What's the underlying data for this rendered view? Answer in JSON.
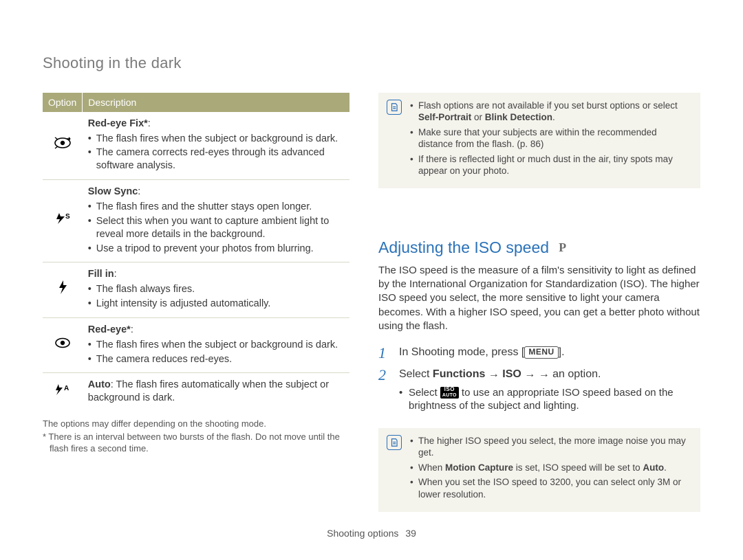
{
  "header": {
    "title": "Shooting in the dark"
  },
  "table": {
    "head": {
      "option": "Option",
      "description": "Description"
    },
    "rows": [
      {
        "icon": "redeye-fix-icon",
        "name": "Red-eye Fix*",
        "bullets": [
          "The flash fires when the subject or background is dark.",
          "The camera corrects red-eyes through its advanced software analysis."
        ]
      },
      {
        "icon": "slow-sync-icon",
        "name": "Slow Sync",
        "bullets": [
          "The flash fires and the shutter stays open longer.",
          "Select this when you want to capture ambient light to reveal more details in the background.",
          "Use a tripod to prevent your photos from blurring."
        ]
      },
      {
        "icon": "fill-in-icon",
        "name": "Fill in",
        "bullets": [
          "The flash always fires.",
          "Light intensity is adjusted automatically."
        ]
      },
      {
        "icon": "redeye-icon",
        "name": "Red-eye*",
        "bullets": [
          "The flash fires when the subject or background is dark.",
          "The camera reduces red-eyes."
        ]
      },
      {
        "icon": "auto-flash-icon",
        "auto_label": "Auto",
        "auto_text": ": The flash fires automatically when the subject or background is dark."
      }
    ]
  },
  "footnotes": {
    "a": "The options may differ depending on the shooting mode.",
    "b": "* There is an interval between two bursts of the flash. Do not move until the flash fires a second time."
  },
  "notes_top": {
    "b1_a": "Flash options are not available if you set burst options or select ",
    "b1_b": "Self-Portrait",
    "b1_c": " or ",
    "b1_d": "Blink Detection",
    "b1_e": ".",
    "b2": "Make sure that your subjects are within the recommended distance from the flash. (p. 86)",
    "b3": "If there is reflected light or much dust in the air, tiny spots may appear on your photo."
  },
  "section": {
    "title": "Adjusting the ISO speed",
    "mode": "P",
    "body": "The ISO speed is the measure of a film's sensitivity to light as defined by the International Organization for Standardization (ISO). The higher ISO speed you select, the more sensitive to light your camera becomes. With a higher ISO speed, you can get a better photo without using the flash."
  },
  "steps": {
    "s1": {
      "num": "1",
      "a": "In Shooting mode, press [",
      "menu": "MENU",
      "b": "]."
    },
    "s2": {
      "num": "2",
      "a": "Select ",
      "functions": "Functions",
      "arrow": " → ",
      "iso": "ISO",
      "b": " → an option.",
      "sub_a": "Select ",
      "sub_b": " to use an appropriate ISO speed based on the brightness of the subject and lighting.",
      "chip_top": "ISO",
      "chip_bot": "AUTO"
    }
  },
  "notes_bottom": {
    "b1": "The higher ISO speed you select, the more image noise you may get.",
    "b2_a": "When ",
    "b2_b": "Motion Capture",
    "b2_c": " is set, ISO speed will be set to ",
    "b2_d": "Auto",
    "b2_e": ".",
    "b3": "When you set the ISO speed to 3200, you can select only 3M or lower resolution."
  },
  "footer": {
    "section": "Shooting options",
    "page": "39"
  }
}
